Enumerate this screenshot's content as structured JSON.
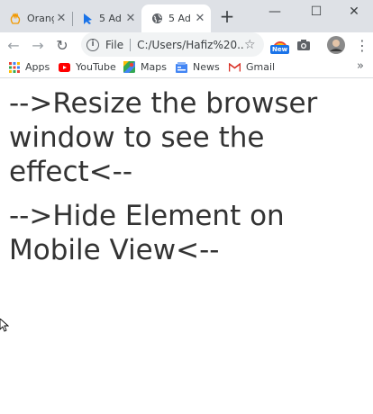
{
  "tabs": [
    {
      "title": "Orang",
      "icon": "orange-hand-icon"
    },
    {
      "title": "5 Ad",
      "icon": "blue-cursor-icon"
    },
    {
      "title": "5 Ad",
      "icon": "globe-icon",
      "active": true
    }
  ],
  "tab_close_glyph": "✕",
  "new_tab_glyph": "+",
  "window_controls": {
    "minimize": "—",
    "maximize": "☐",
    "close": "✕"
  },
  "toolbar": {
    "back": "←",
    "forward": "→",
    "reload": "↻",
    "info": "i",
    "address_label": "File",
    "address_url": "C:/Users/Hafiz%20...",
    "star": "☆",
    "new_badge": "New",
    "menu": "⋮"
  },
  "bookmarks": [
    {
      "label": "Apps",
      "icon": "apps-grid-icon"
    },
    {
      "label": "YouTube",
      "icon": "youtube-icon"
    },
    {
      "label": "Maps",
      "icon": "maps-icon"
    },
    {
      "label": "News",
      "icon": "news-icon"
    },
    {
      "label": "Gmail",
      "icon": "gmail-icon"
    }
  ],
  "bookmarks_more": "»",
  "page": {
    "heading_1": "-->Resize the browser window to see the effect<--",
    "heading_2": "-->Hide Element on Mobile View<--"
  },
  "colors": {
    "tab_strip": "#dee1e6",
    "text": "#333333",
    "accent": "#1a73e8",
    "youtube": "#ff0000",
    "gmail": "#d93025"
  }
}
